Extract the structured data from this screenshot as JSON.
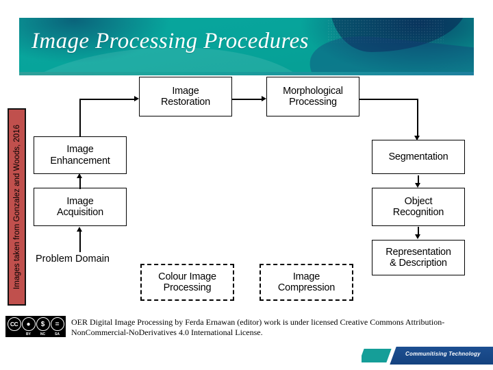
{
  "slide": {
    "title": "Image Processing Procedures",
    "side_credit": "Images taken from Gonzalez and Woods, 2016"
  },
  "diagram": {
    "boxes": [
      {
        "id": "image-restoration",
        "label": "Image\nRestoration"
      },
      {
        "id": "morphological-processing",
        "label": "Morphological\nProcessing"
      },
      {
        "id": "image-enhancement",
        "label": "Image\nEnhancement"
      },
      {
        "id": "image-acquisition",
        "label": "Image\nAcquisition"
      },
      {
        "id": "segmentation",
        "label": "Segmentation"
      },
      {
        "id": "object-recognition",
        "label": "Object\nRecognition"
      },
      {
        "id": "representation-description",
        "label": "Representation\n& Description"
      },
      {
        "id": "colour-image-processing",
        "label": "Colour Image\nProcessing"
      },
      {
        "id": "image-compression",
        "label": "Image\nCompression"
      }
    ],
    "labels": {
      "problem_domain": "Problem Domain"
    },
    "box_text": {
      "image_restoration_l1": "Image",
      "image_restoration_l2": "Restoration",
      "morphological_l1": "Morphological",
      "morphological_l2": "Processing",
      "enhancement_l1": "Image",
      "enhancement_l2": "Enhancement",
      "acquisition_l1": "Image",
      "acquisition_l2": "Acquisition",
      "segmentation_l1": "Segmentation",
      "object_recognition_l1": "Object",
      "object_recognition_l2": "Recognition",
      "representation_l1": "Representation",
      "representation_l2": "& Description",
      "colour_l1": "Colour Image",
      "colour_l2": "Processing",
      "compression_l1": "Image",
      "compression_l2": "Compression"
    }
  },
  "footer": {
    "license_line1": "OER Digital Image Processing by Ferda Ernawan (editor) work is under licensed Creative Commons Attribution-",
    "license_line2": "NonCommercial-NoDerivatives 4.0 International License.",
    "cc_icons": [
      {
        "glyph": "CC",
        "sub": ""
      },
      {
        "glyph": "ı",
        "sub": "BY"
      },
      {
        "glyph": "$",
        "sub": "NC"
      },
      {
        "glyph": "=",
        "sub": "SA"
      }
    ],
    "brand_text": "Communitising Technology"
  },
  "colors": {
    "header_teal": "#06a096",
    "sidebar_red": "#c0504d",
    "footer_blue": "#1d4f91",
    "footer_teal": "#159e98",
    "diagram_line": "#000000"
  }
}
